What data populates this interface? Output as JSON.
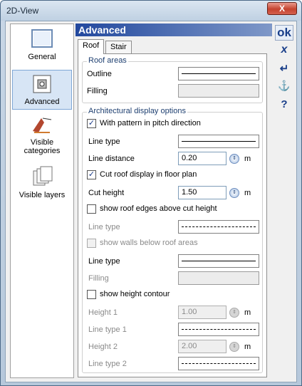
{
  "window": {
    "title": "2D-View",
    "close_label": "X"
  },
  "nav": {
    "items": [
      {
        "label": "General"
      },
      {
        "label": "Advanced"
      },
      {
        "label": "Visible categories"
      },
      {
        "label": "Visible layers"
      }
    ]
  },
  "header": {
    "title": "Advanced"
  },
  "toolbar": {
    "ok_label": "ok",
    "cancel_label": "x",
    "apply_label": "↵",
    "anchor_label": "⚓",
    "help_label": "?"
  },
  "tabs": [
    {
      "label": "Roof"
    },
    {
      "label": "Stair"
    }
  ],
  "roof_areas": {
    "title": "Roof areas",
    "outline_label": "Outline",
    "filling_label": "Filling"
  },
  "arch": {
    "title": "Architectural display options",
    "pitch_pattern": {
      "label": "With pattern in pitch direction",
      "checked": true
    },
    "line_type_label": "Line type",
    "line_distance": {
      "label": "Line distance",
      "value": "0.20",
      "unit": "m"
    },
    "cut_roof": {
      "label": "Cut roof display in floor plan",
      "checked": true
    },
    "cut_height": {
      "label": "Cut height",
      "value": "1.50",
      "unit": "m"
    },
    "roof_edges": {
      "label": "show roof edges above cut height",
      "checked": false
    },
    "roof_edges_line_type_label": "Line type",
    "walls_below": {
      "label": "show walls below roof areas",
      "checked": false
    },
    "walls_line_type_label": "Line type",
    "walls_filling_label": "Filling",
    "height_contour": {
      "label": "show height contour",
      "checked": false
    },
    "height1": {
      "label": "Height 1",
      "value": "1.00",
      "unit": "m"
    },
    "line_type1_label": "Line type 1",
    "height2": {
      "label": "Height 2",
      "value": "2.00",
      "unit": "m"
    },
    "line_type2_label": "Line type 2"
  }
}
